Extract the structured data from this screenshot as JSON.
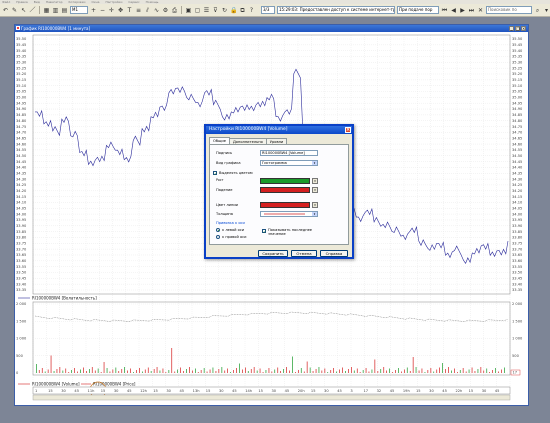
{
  "menubar": [
    "Файл",
    "Правка",
    "Вид",
    "Навигатор",
    "Котировки",
    "Окна",
    "Настройки",
    "Сервис",
    "Помощь"
  ],
  "toolbar": {
    "timeframe": "M1",
    "counter": "3/3",
    "news": "15:29:03: Предоставлен доступ к системе интернет-трейдинга!",
    "combo": "При подаче пор",
    "search_placeholder": "Поисковик по"
  },
  "chart_window": {
    "title": "График RI100000BW4 [1 минута]",
    "price_ticks": [
      "35.50",
      "35.45",
      "35.40",
      "35.35",
      "35.30",
      "35.25",
      "35.20",
      "35.15",
      "35.10",
      "35.05",
      "35.00",
      "34.95",
      "34.90",
      "34.85",
      "34.80",
      "34.75",
      "34.70",
      "34.65",
      "34.60",
      "34.55",
      "34.50",
      "34.45",
      "34.40",
      "34.35",
      "34.30",
      "34.25",
      "34.20",
      "34.15",
      "34.10",
      "34.05",
      "34.00",
      "33.95",
      "33.90",
      "33.85",
      "33.80",
      "33.75",
      "33.70",
      "33.65",
      "33.60",
      "33.55",
      "33.50",
      "33.45",
      "33.40",
      "33.35"
    ],
    "price_legend": "RI100000BW4 [Волатильность]",
    "volume_ticks": [
      "2 000",
      "1 500",
      "1 000",
      "500",
      "0"
    ],
    "volume_legend_1": "RI100000BW4 [Volume]",
    "volume_legend_2": "RI100000BW4 [Price]",
    "volume_last": "17",
    "time_labels": [
      "1",
      "15",
      "30",
      "45",
      "11h",
      "15",
      "30",
      "45",
      "12h",
      "15",
      "30",
      "45",
      "13h",
      "15",
      "30",
      "45",
      "14h",
      "15",
      "30",
      "45",
      "20h",
      "15",
      "30",
      "45",
      "3",
      "17",
      "32",
      "45",
      "19h",
      "15",
      "30",
      "45",
      "22h",
      "15",
      "30",
      "45"
    ]
  },
  "dialog": {
    "title": "Настройки RI100000BW4 [Volume]",
    "tabs": [
      "Общие",
      "Дополнительно",
      "Уровни"
    ],
    "caption_label": "Подпись",
    "caption_value": "RI100000BW4 [Volume]",
    "chart_type_label": "Вид графика",
    "chart_type_value": "Гистограмма",
    "highlight_label": "Выделять цветом",
    "rise_label": "Рост",
    "fall_label": "Падение",
    "line_color_label": "Цвет линии",
    "thickness_label": "Толщина",
    "axis_group": "Привязка к оси",
    "left_axis": "к левой оси",
    "right_axis": "к правой оси",
    "show_last": "Показывать последнее значение",
    "save": "Сохранить",
    "cancel": "Отмена",
    "help": "Справка",
    "colors": {
      "rise": "#1a9a2a",
      "fall": "#d42020",
      "line": "#d42020"
    }
  },
  "chart_data": {
    "type": "line",
    "price_series": {
      "name": "RI100000BW4 [Волатильность]",
      "ylim": [
        33.35,
        35.5
      ]
    },
    "volume_series": {
      "name": "RI100000BW4 [Volume]",
      "ylim": [
        0,
        2000
      ]
    }
  }
}
